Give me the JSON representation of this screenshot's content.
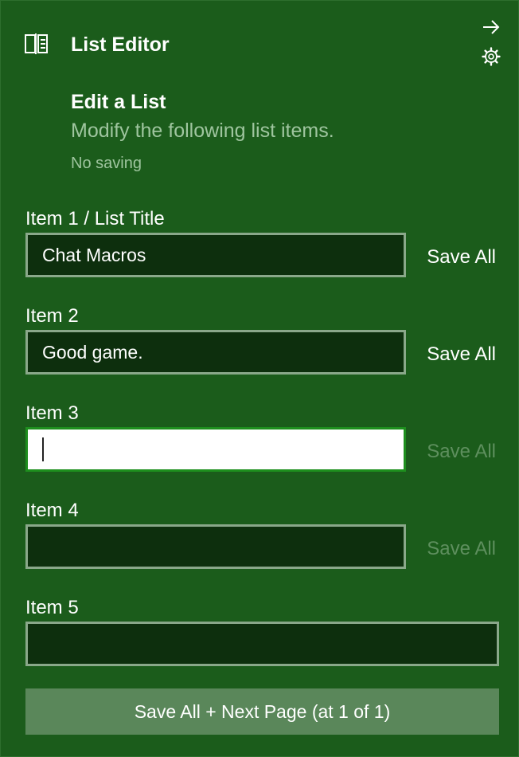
{
  "header": {
    "title": "List Editor",
    "icon": "list-book-icon",
    "close_icon": "arrow-right-icon",
    "settings_icon": "gear-icon"
  },
  "section": {
    "title": "Edit a List",
    "description": "Modify the following list items.",
    "note": "No saving"
  },
  "fields": [
    {
      "label": "Item 1 / List Title",
      "value": "Chat Macros",
      "save_label": "Save All",
      "save_enabled": true
    },
    {
      "label": "Item 2",
      "value": "Good game.",
      "save_label": "Save All",
      "save_enabled": true
    },
    {
      "label": "Item 3",
      "value": "",
      "save_label": "Save All",
      "save_enabled": false,
      "focused": true
    },
    {
      "label": "Item 4",
      "value": "",
      "save_label": "Save All",
      "save_enabled": false
    },
    {
      "label": "Item 5",
      "value": ""
    }
  ],
  "footer": {
    "button_label": "Save All + Next Page (at 1 of 1)"
  },
  "colors": {
    "background": "#1b5c1b",
    "input_bg": "#0d2f0d",
    "input_border": "#8aa88a",
    "focus_border": "#1e8f1e",
    "muted_text": "#9fc59f",
    "disabled_text": "#5e8f5e",
    "button_bg": "#5a875a"
  }
}
